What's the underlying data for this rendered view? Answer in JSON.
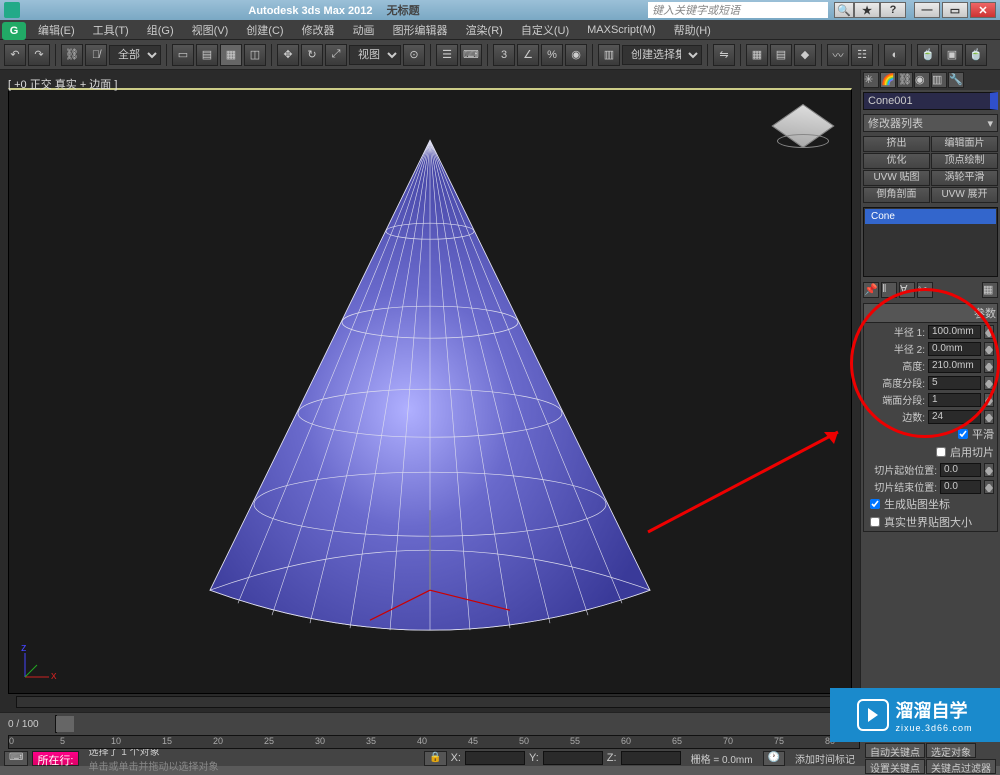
{
  "title": {
    "app": "Autodesk 3ds Max  2012",
    "doc": "无标题",
    "search_placeholder": "键入关键字或短语"
  },
  "menu": [
    "编辑(E)",
    "工具(T)",
    "组(G)",
    "视图(V)",
    "创建(C)",
    "修改器",
    "动画",
    "图形编辑器",
    "渲染(R)",
    "自定义(U)",
    "MAXScript(M)",
    "帮助(H)"
  ],
  "toolbar": {
    "filter": "全部",
    "mode": "视图",
    "create_set": "创建选择集"
  },
  "viewport": {
    "label": "[ +0 正交 真实 + 边面 ]"
  },
  "side": {
    "object_name": "Cone001",
    "modlist_placeholder": "修改器列表",
    "buttons": [
      "挤出",
      "编辑面片",
      "优化",
      "顶点绘制",
      "UVW 贴图",
      "涡轮平滑",
      "倒角剖面",
      "UVW 展开"
    ],
    "stack_item": "Cone"
  },
  "params": {
    "header": "参数",
    "radius1_label": "半径 1:",
    "radius1": "100.0mm",
    "radius2_label": "半径 2:",
    "radius2": "0.0mm",
    "height_label": "高度:",
    "height": "210.0mm",
    "heightsegs_label": "高度分段:",
    "heightsegs": "5",
    "capsegs_label": "端面分段:",
    "capsegs": "1",
    "sides_label": "边数:",
    "sides": "24",
    "smooth_label": "平滑",
    "slice_on_label": "启用切片",
    "slice_from_label": "切片起始位置:",
    "slice_from": "0.0",
    "slice_to_label": "切片结束位置:",
    "slice_to": "0.0",
    "gen_uv_label": "生成贴图坐标",
    "realworld_label": "真实世界贴图大小"
  },
  "time": {
    "pos": "0 / 100",
    "ticks": [
      "0",
      "5",
      "10",
      "15",
      "20",
      "25",
      "30",
      "35",
      "40",
      "45",
      "50",
      "55",
      "60",
      "65",
      "70",
      "75",
      "80"
    ]
  },
  "status": {
    "sel_text": "选择了 1 个对象",
    "hint": "单击或单击并拖动以选择对象",
    "x_label": "X:",
    "y_label": "Y:",
    "z_label": "Z:",
    "grid_label": "栅格 = 0.0mm",
    "autokey": "自动关键点",
    "selkey": "选定对象",
    "setkey": "设置关键点",
    "keyfilter": "关键点过滤器",
    "now_btn": "所在行:",
    "addtime": "添加时间标记"
  },
  "watermark": {
    "big": "溜溜自学",
    "small": "zixue.3d66.com"
  }
}
